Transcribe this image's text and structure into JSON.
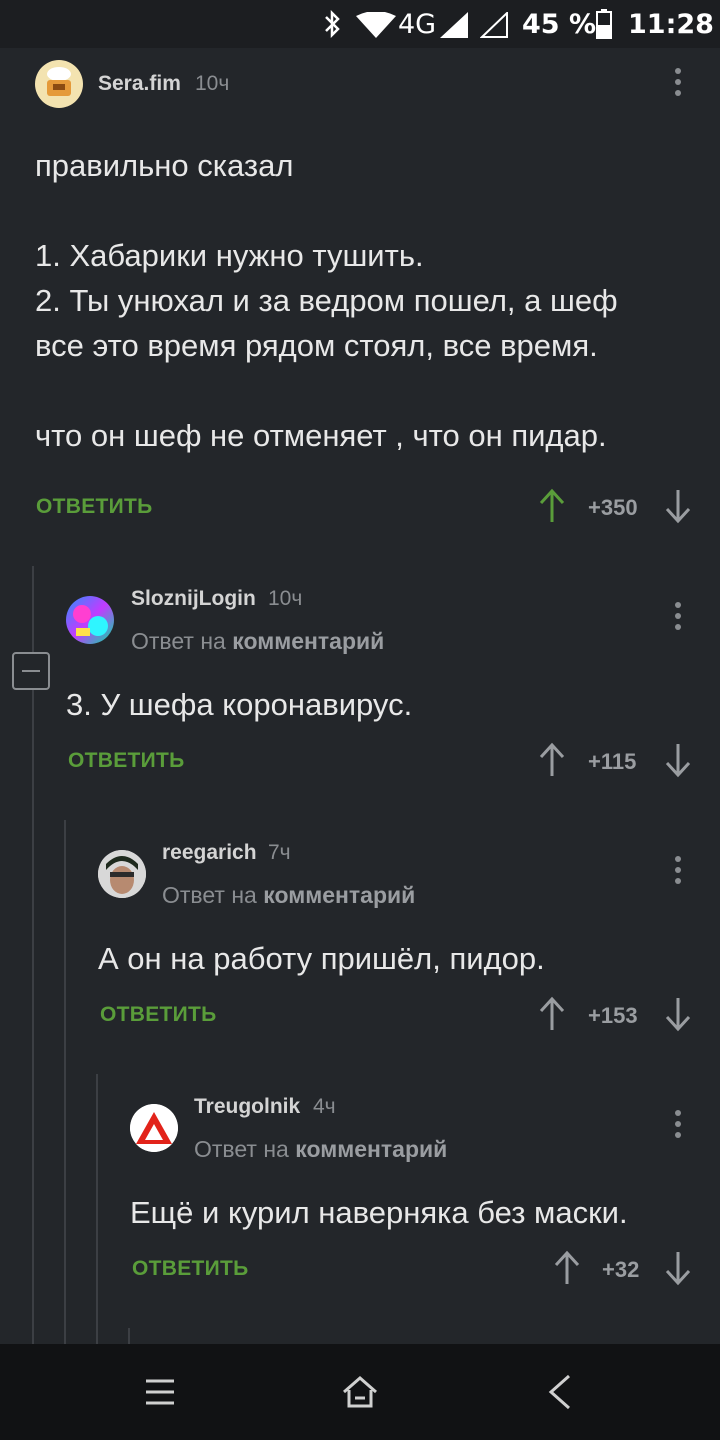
{
  "status_bar": {
    "signal": "4G",
    "battery": "45 %",
    "time": "11:28"
  },
  "comments": [
    {
      "username": "Sera.fim",
      "time": "10ч",
      "text": "правильно сказал\n\n1. Хабарики нужно тушить.\n2. Ты унюхал и за ведром пошел, а шеф\nвсе это время рядом стоял, все время.\n\nчто он шеф не отменяет , что он пидар.",
      "reply_label": "ОТВЕТИТЬ",
      "rating": "+350"
    },
    {
      "username": "SloznijLogin",
      "time": "10ч",
      "reply_prefix": "Ответ на",
      "reply_target": "комментарий",
      "text": "3. У шефа коронавирус.",
      "reply_label": "ОТВЕТИТЬ",
      "rating": "+115"
    },
    {
      "username": "reegarich",
      "time": "7ч",
      "reply_prefix": "Ответ на",
      "reply_target": "комментарий",
      "text": "А он на работу пришёл, пидор.",
      "reply_label": "ОТВЕТИТЬ",
      "rating": "+153"
    },
    {
      "username": "Treugolnik",
      "time": "4ч",
      "reply_prefix": "Ответ на",
      "reply_target": "комментарий",
      "text": "Ещё и курил наверняка без маски.",
      "reply_label": "ОТВЕТИТЬ",
      "rating": "+32"
    }
  ],
  "icons": {
    "menu": "menu-dots-icon",
    "upvote": "arrow-up-icon",
    "downvote": "arrow-down-icon",
    "collapse": "collapse-minus-icon",
    "nav_menu": "hamburger-icon",
    "nav_home": "home-icon",
    "nav_back": "back-icon"
  },
  "colors": {
    "background": "#23262a",
    "accent_green": "#5a9d3a",
    "upvoted": "#5a9d3a",
    "muted": "#8a8d91"
  }
}
